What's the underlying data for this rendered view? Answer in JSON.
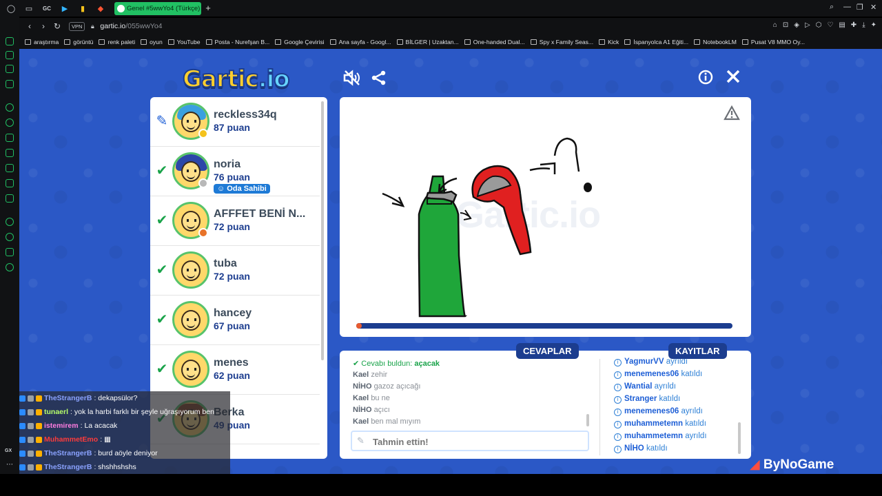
{
  "browser": {
    "tab_title": "Genel #5wwYo4 (Türkçe)",
    "url_host": "gartic.io",
    "url_path": "/055wwYo4",
    "vpn_label": "VPN",
    "sidebar_label": "GX",
    "top_icons": [
      "GC"
    ],
    "bookmarks": [
      "araştırma",
      "görüntü",
      "renk paleti",
      "oyun",
      "YouTube",
      "Posta - Nurefşan B...",
      "Google Çevirisi",
      "Ana sayfa - Googl...",
      "BİLGER | Uzaktan...",
      "One-handed Dual...",
      "Spy x Family Seas...",
      "Kick",
      "İspanyolca A1 Eğiti...",
      "NotebookLM",
      "Pusat V8 MMO Oy..."
    ]
  },
  "game": {
    "logo_main": "Gartic",
    "logo_suffix": ".io",
    "watermark": "Gartic.io",
    "owner_badge": "Oda Sahibi",
    "progress": 0.0,
    "players": [
      {
        "name": "reckless34q",
        "score": "87 puan",
        "status": "drawing",
        "dot": "#f4c21c",
        "hair": "blue"
      },
      {
        "name": "noria",
        "score": "76 puan",
        "status": "guessed",
        "dot": "#b8b8b8",
        "hair": "navy",
        "owner": true
      },
      {
        "name": "AFFFET BENİ N...",
        "score": "72 puan",
        "status": "guessed",
        "dot": "#e8732a",
        "hair": ""
      },
      {
        "name": "tuba",
        "score": "72 puan",
        "status": "guessed",
        "dot": "",
        "hair": ""
      },
      {
        "name": "hancey",
        "score": "67 puan",
        "status": "guessed",
        "dot": "",
        "hair": ""
      },
      {
        "name": "menes",
        "score": "62 puan",
        "status": "guessed",
        "dot": "",
        "hair": ""
      },
      {
        "name": "Berka",
        "score": "49 puan",
        "status": "guessed",
        "dot": "",
        "hair": "brown"
      }
    ],
    "answers_label": "CEVAPLAR",
    "logs_label": "KAYITLAR",
    "found_prefix": "Cevabı buldun:",
    "found_word": "açacak",
    "answers": [
      {
        "user": "Kael",
        "text": "zehir"
      },
      {
        "user": "NİHO",
        "text": "gazoz açıcağı"
      },
      {
        "user": "Kael",
        "text": "bu ne"
      },
      {
        "user": "NİHO",
        "text": "açıcı"
      },
      {
        "user": "Kael",
        "text": "ben mal mıyım"
      }
    ],
    "guess_placeholder": "Tahmin ettin!",
    "logs": [
      {
        "user": "YagmurVV",
        "action": "ayrıldı"
      },
      {
        "user": "menemenes06",
        "action": "katıldı"
      },
      {
        "user": "Wantial",
        "action": "ayrıldı"
      },
      {
        "user": "Stranger",
        "action": "katıldı"
      },
      {
        "user": "menemenes06",
        "action": "ayrıldı"
      },
      {
        "user": "muhammetemn",
        "action": "katıldı"
      },
      {
        "user": "muhammetemn",
        "action": "ayrıldı"
      },
      {
        "user": "NİHO",
        "action": "katıldı"
      }
    ],
    "sponsor_prefix": "By",
    "sponsor_main": "NoGame"
  },
  "twitch_chat": [
    {
      "user": "TheStrangerB",
      "color": "#8aa2ff",
      "text": ": dekapsülor?"
    },
    {
      "user": "tunaerl",
      "color": "#b7ff6a",
      "text": ": yok la harbi farklı bir şeyle uğraşıyorum ben"
    },
    {
      "user": "istemirem",
      "color": "#ff7de0",
      "text": ": La acacak"
    },
    {
      "user": "MuhammetEmo",
      "color": "#ff3b3b",
      "text": ": ▦"
    },
    {
      "user": "TheStrangerB",
      "color": "#8aa2ff",
      "text": ": burd aöyle deniyor"
    },
    {
      "user": "TheStrangerB",
      "color": "#8aa2ff",
      "text": ": shshhshshs"
    }
  ]
}
